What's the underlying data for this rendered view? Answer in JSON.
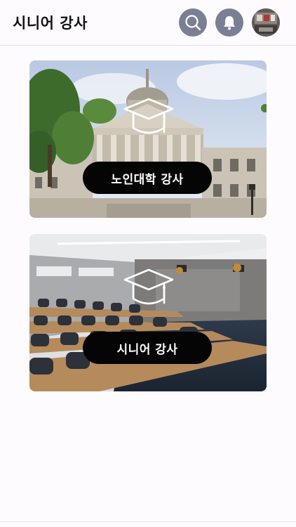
{
  "header": {
    "title": "시니어 강사",
    "icons": {
      "search": "search-icon",
      "notifications": "bell-icon",
      "profile": "avatar"
    }
  },
  "cards": [
    {
      "label": "노인대학 강사",
      "icon": "graduation-cap-icon"
    },
    {
      "label": "시니어 강사",
      "icon": "graduation-cap-icon"
    }
  ],
  "colors": {
    "background": "#fdfbfe",
    "header_button": "#7a7f94",
    "pill": "#050505",
    "pill_text": "#ffffff"
  }
}
